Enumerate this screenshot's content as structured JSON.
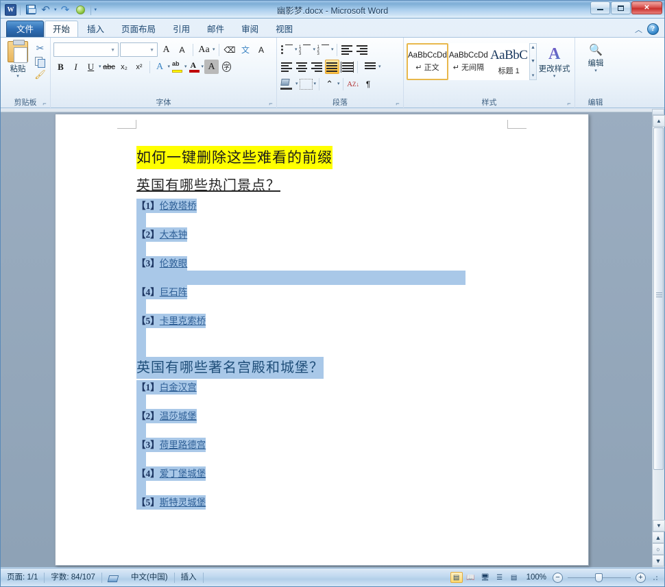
{
  "window": {
    "title": "幽影梦.docx - Microsoft Word",
    "minimize_label": "最小化",
    "restore_label": "还原",
    "close_label": "✕"
  },
  "quick_access": {
    "logo": "W",
    "items": [
      {
        "name": "save-icon",
        "label": "保存"
      },
      {
        "name": "undo-icon",
        "label": "撤销"
      },
      {
        "name": "redo-icon",
        "label": "恢复"
      },
      {
        "name": "green-circle-icon",
        "label": ""
      },
      {
        "name": "customize-qat-icon",
        "label": ""
      }
    ]
  },
  "tabs": [
    {
      "label": "文件",
      "type": "file"
    },
    {
      "label": "开始",
      "active": true
    },
    {
      "label": "插入"
    },
    {
      "label": "页面布局"
    },
    {
      "label": "引用"
    },
    {
      "label": "邮件"
    },
    {
      "label": "审阅"
    },
    {
      "label": "视图"
    }
  ],
  "tab_right": {
    "collapse": "︿",
    "help": "?"
  },
  "ribbon": {
    "clipboard": {
      "group_label": "剪贴板",
      "paste_label": "粘贴",
      "cut_label": "剪切",
      "copy_label": "复制",
      "format_painter_label": "格式刷"
    },
    "font": {
      "group_label": "字体",
      "font_name_value": "",
      "font_size_value": "",
      "grow_font": "A",
      "shrink_font": "A",
      "change_case": "Aa",
      "clear_format": "Aa",
      "phonetic": "文",
      "char_border": "A",
      "bold": "B",
      "italic": "I",
      "underline": "U",
      "strikethrough": "abc",
      "subscript": "x₂",
      "superscript": "x²",
      "text_effects": "A",
      "highlight": "ab",
      "font_color": "A",
      "shading_char": "A",
      "enclose_char": "字"
    },
    "paragraph": {
      "group_label": "段落",
      "bullets": "•",
      "numbering": "1.",
      "multilevel": "1)",
      "decrease_indent": "◄",
      "increase_indent": "►",
      "align_left": "左对齐",
      "align_center": "居中",
      "align_right": "右对齐",
      "align_justify": "两端对齐",
      "distributed": "分散对齐",
      "line_spacing": "行距",
      "shading": "底纹",
      "borders": "边框",
      "chinese_layout": "中文版式",
      "sort": "排序",
      "show_marks": "显示编辑标记"
    },
    "styles": {
      "group_label": "样式",
      "gallery": [
        {
          "preview": "AaBbCcDd",
          "name": "正文",
          "selected": true,
          "mark": "↵"
        },
        {
          "preview": "AaBbCcDd",
          "name": "无间隔",
          "selected": false,
          "mark": "↵"
        },
        {
          "preview": "AaBbC",
          "name": "标题 1",
          "selected": false,
          "mark": ""
        }
      ],
      "change_styles_label": "更改样式"
    },
    "editing": {
      "group_label": "编辑",
      "button_label": "编辑"
    }
  },
  "document": {
    "title_line": "如何一键删除这些难看的前缀",
    "sections": [
      {
        "heading": "英国有哪些热门景点？",
        "heading_highlighted": false,
        "items": [
          {
            "num": "【1】",
            "text": "伦敦塔桥"
          },
          {
            "num": "【2】",
            "text": "大本钟"
          },
          {
            "num": "【3】",
            "text": "伦敦眼"
          },
          {
            "num": "【4】",
            "text": "巨石阵"
          },
          {
            "num": "【5】",
            "text": "卡里克索桥"
          }
        ]
      },
      {
        "heading": "英国有哪些著名宫殿和城堡？",
        "heading_highlighted": true,
        "items": [
          {
            "num": "【1】",
            "text": "白金汉宫"
          },
          {
            "num": "【2】",
            "text": "温莎城堡"
          },
          {
            "num": "【3】",
            "text": "荷里路德宫"
          },
          {
            "num": "【4】",
            "text": "爱丁堡城堡"
          },
          {
            "num": "【5】",
            "text": "斯特灵城堡"
          }
        ]
      }
    ]
  },
  "status_bar": {
    "page": "页面: 1/1",
    "words": "字数: 84/107",
    "proofing_icon": "proofing-errors-icon",
    "language": "中文(中国)",
    "insert_mode": "插入",
    "view_buttons": [
      "页面视图",
      "阅读版式视图",
      "Web版式视图",
      "大纲视图",
      "草稿视图"
    ],
    "zoom_level": "100%",
    "zoom_out": "−",
    "zoom_in": "+"
  },
  "colors": {
    "accent_blue": "#2b579a",
    "highlight_yellow": "#ffff00",
    "selection_blue": "#a9c8e8",
    "link_blue": "#2e5f96",
    "heading_blue": "#1f4e79"
  }
}
